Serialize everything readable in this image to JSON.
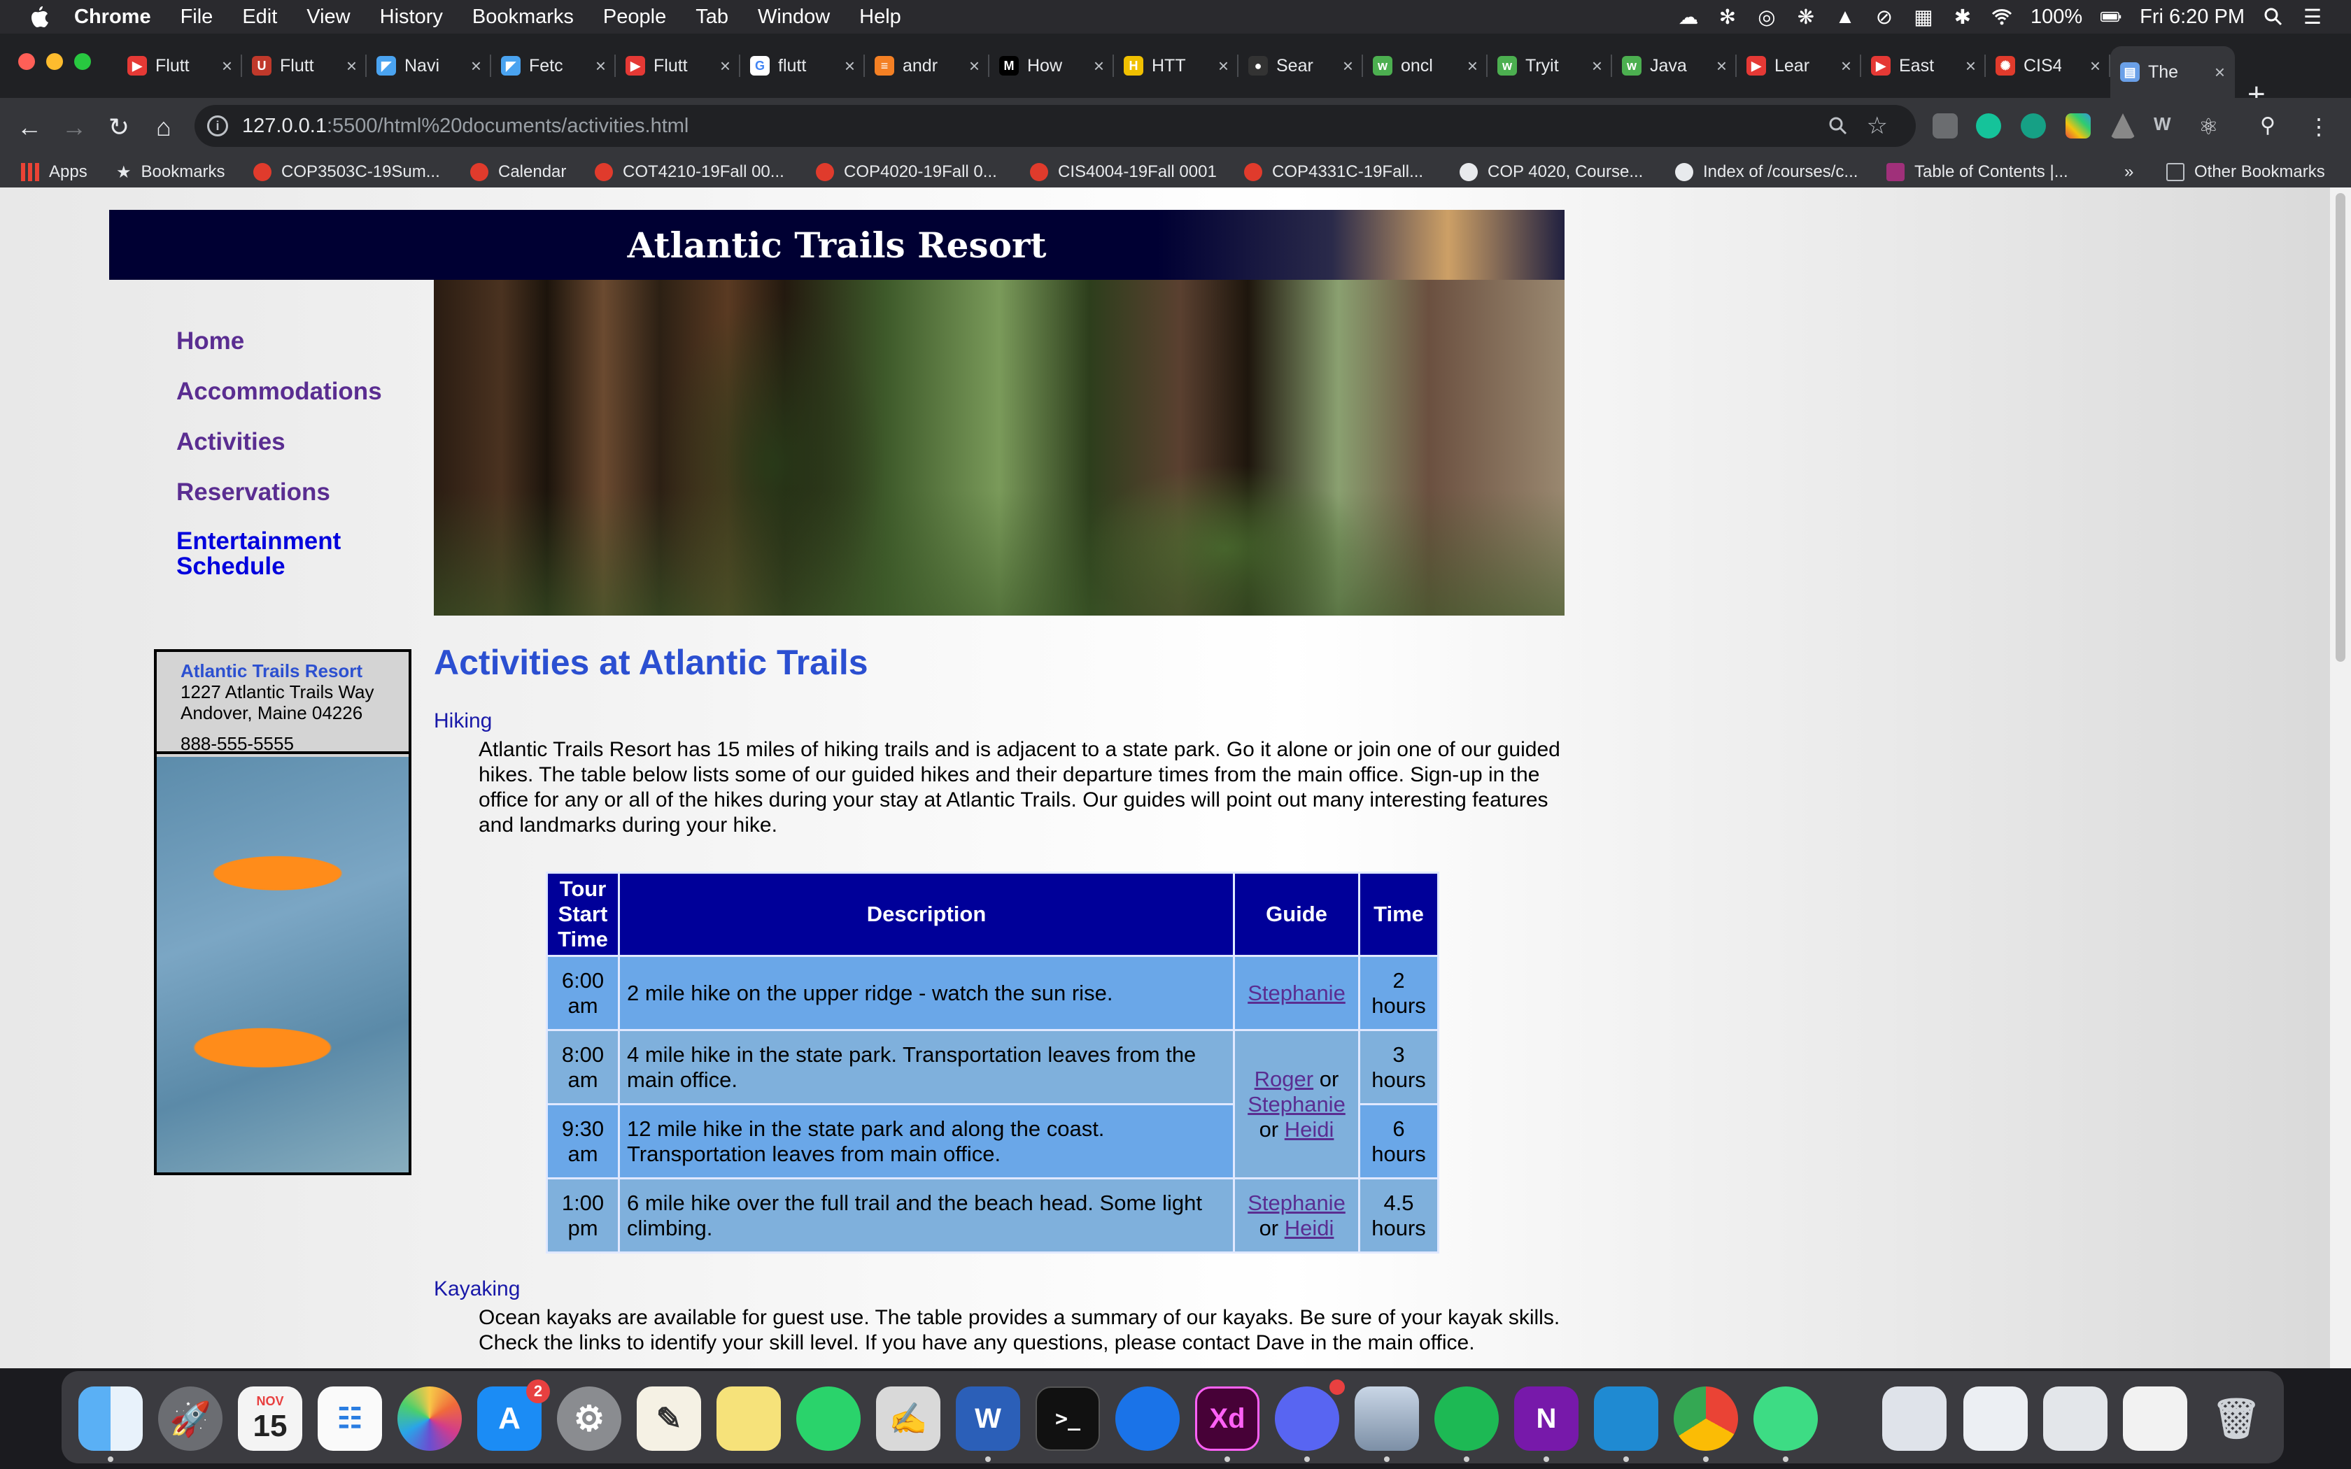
{
  "menubar": {
    "app": "Chrome",
    "items": [
      "File",
      "Edit",
      "View",
      "History",
      "Bookmarks",
      "People",
      "Tab",
      "Window",
      "Help"
    ],
    "battery": "100%",
    "clock": "Fri 6:20 PM"
  },
  "tabs": [
    {
      "label": "Flutt",
      "icon": "youtube-icon",
      "color": "#e53935"
    },
    {
      "label": "Flutt",
      "icon": "udemy-icon",
      "color": "#c0392b"
    },
    {
      "label": "Navi",
      "icon": "flutter-icon",
      "color": "#4aa3f0"
    },
    {
      "label": "Fetc",
      "icon": "flutter-icon",
      "color": "#4aa3f0"
    },
    {
      "label": "Flutt",
      "icon": "youtube-icon",
      "color": "#e53935"
    },
    {
      "label": "flutt",
      "icon": "google-icon",
      "color": "#ffffff"
    },
    {
      "label": "andr",
      "icon": "stackoverflow-icon",
      "color": "#f48024"
    },
    {
      "label": "How",
      "icon": "medium-icon",
      "color": "#000000"
    },
    {
      "label": "HTT",
      "icon": "hackerrank-icon",
      "color": "#f0c000"
    },
    {
      "label": "Sear",
      "icon": "github-icon",
      "color": "#333333"
    },
    {
      "label": "oncl",
      "icon": "w3schools-icon",
      "color": "#4caf50"
    },
    {
      "label": "Tryit",
      "icon": "w3schools-icon",
      "color": "#4caf50"
    },
    {
      "label": "Java",
      "icon": "w3schools-icon",
      "color": "#4caf50"
    },
    {
      "label": "Lear",
      "icon": "youtube-icon",
      "color": "#e53935"
    },
    {
      "label": "East",
      "icon": "youtube-icon",
      "color": "#e53935"
    },
    {
      "label": "CIS4",
      "icon": "canvas-icon",
      "color": "#e03b2c"
    },
    {
      "label": "The",
      "icon": "page-icon",
      "color": "#6aa0e8"
    }
  ],
  "omnibox": {
    "host": "127.0.0.1",
    "rest": ":5500/html%20documents/activities.html"
  },
  "bookmarks": [
    {
      "label": "Apps"
    },
    {
      "label": "Bookmarks"
    },
    {
      "label": "COP3503C-19Sum..."
    },
    {
      "label": "Calendar"
    },
    {
      "label": "COT4210-19Fall 00..."
    },
    {
      "label": "COP4020-19Fall 0..."
    },
    {
      "label": "CIS4004-19Fall 0001"
    },
    {
      "label": "COP4331C-19Fall..."
    },
    {
      "label": "COP 4020, Course..."
    },
    {
      "label": "Index of /courses/c..."
    },
    {
      "label": "Table of Contents |..."
    }
  ],
  "bookmarks_more": "»",
  "bookmarks_other": "Other Bookmarks",
  "page": {
    "site_title": "Atlantic Trails Resort",
    "nav": [
      "Home",
      "Accommodations",
      "Activities",
      "Reservations"
    ],
    "nav_entertainment": [
      "Entertainment",
      "Schedule"
    ],
    "contact": {
      "name": "Atlantic Trails Resort",
      "street": "1227 Atlantic Trails Way",
      "city": "Andover, Maine 04226",
      "phone": "888-555-5555"
    },
    "heading": "Activities at Atlantic Trails",
    "hiking": {
      "title": "Hiking",
      "text": "Atlantic Trails Resort has 15 miles of hiking trails and is adjacent to a state park. Go it alone or join one of our guided hikes. The table below lists some of our guided hikes and their departure times from the main office. Sign-up in the office for any or all of the hikes during your stay at Atlantic Trails. Our guides will point out many interesting features and landmarks during your hike."
    },
    "table": {
      "headers": [
        "Tour Start Time",
        "Description",
        "Guide",
        "Time"
      ],
      "rows": [
        {
          "start": "6:00 am",
          "desc": "2 mile hike on the upper ridge - watch the sun rise.",
          "time": "2 hours"
        },
        {
          "start": "8:00 am",
          "desc": "4 mile hike in the state park. Transportation leaves from the main office.",
          "time": "3 hours"
        },
        {
          "start": "9:30 am",
          "desc": "12 mile hike in the state park and along the coast. Transportation leaves from main office.",
          "time": "6 hours"
        },
        {
          "start": "1:00 pm",
          "desc": "6 mile hike over the full trail and the beach head. Some light climbing.",
          "time": "4.5 hours"
        }
      ],
      "guides": {
        "stephanie": "Stephanie",
        "roger": "Roger",
        "heidi": "Heidi",
        "or": "or"
      }
    },
    "kayaking": {
      "title": "Kayaking",
      "text": "Ocean kayaks are available for guest use. The table provides a summary of our kayaks. Be sure of your kayak skills. Check the links to identify your skill level. If you have any questions, please contact Dave in the main office."
    }
  },
  "dock": {
    "calendar_month": "NOV",
    "calendar_day": "15",
    "appstore_badge": "2",
    "xd_label": "Xd",
    "word_label": "W",
    "onenote_label": "N"
  }
}
